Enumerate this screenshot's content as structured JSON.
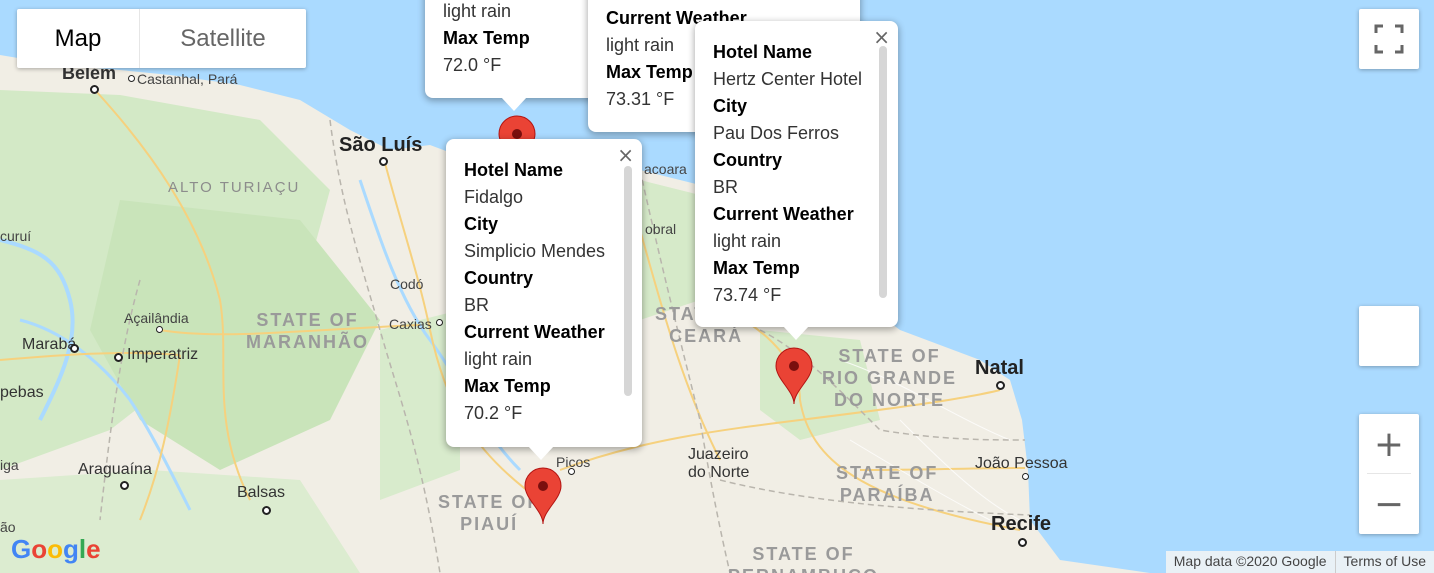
{
  "map_type": {
    "map_label": "Map",
    "satellite_label": "Satellite",
    "selected": "Map"
  },
  "places": {
    "belem": "Belém",
    "castanhal": "Castanhal, Pará",
    "sao_luis": "São Luís",
    "alto_turiacu": "ALTO TURIAÇU",
    "coroatá": "Codó",
    "caxias": "Caxias",
    "acailandia": "Açailândia",
    "maraba": "Marabá",
    "imperatriz": "Imperatriz",
    "araguaina": "Araguaína",
    "balsas": "Balsas",
    "picos": "Picos",
    "juazeiro": "Juazeiro\ndo Norte",
    "natal": "Natal",
    "joao_pessoa": "João Pessoa",
    "recife": "Recife",
    "jacobina_partial": "curuí",
    "pebas_partial": "pebas",
    "iga_partial": "iga",
    "sobral_partial": "obral",
    "camocim_partial": "acoara",
    "ao_partial": "ão"
  },
  "regions": {
    "maranhao": "STATE OF\nMARANHÃO",
    "piaui": "STATE OF\nPIAUÍ",
    "ceara": "STATE OF\nCEARÁ",
    "rio_grande_do_norte": "STATE OF\nRIO GRANDE\nDO NORTE",
    "paraiba": "STATE OF\nPARAÍBA",
    "pernambuco": "STATE OF\nPERNAMBUCO"
  },
  "info_windows": [
    {
      "id": "pau-dos-ferros",
      "hotel_label": "Hotel Name",
      "hotel": "Hertz Center Hotel",
      "city_label": "City",
      "city": "Pau Dos Ferros",
      "country_label": "Country",
      "country": "BR",
      "weather_label": "Current Weather",
      "weather": "light rain",
      "temp_label": "Max Temp",
      "temp": "73.74 °F"
    },
    {
      "id": "simplicio-mendes",
      "hotel_label": "Hotel Name",
      "hotel": "Fidalgo",
      "city_label": "City",
      "city": "Simplicio Mendes",
      "country_label": "Country",
      "country": "BR",
      "weather_label": "Current Weather",
      "weather": "light rain",
      "temp_label": "Max Temp",
      "temp": "70.2 °F"
    },
    {
      "id": "partial-top-left",
      "weather": "light rain",
      "temp_label": "Max Temp",
      "temp": "72.0 °F"
    },
    {
      "id": "partial-top-middle",
      "weather_label": "Current Weather",
      "weather": "light rain",
      "temp_label": "Max Temp",
      "temp": "73.31 °F"
    }
  ],
  "close_glyph": "×",
  "controls": {
    "zoom_in": "+",
    "zoom_out": "−"
  },
  "logo": {
    "letters": [
      "G",
      "o",
      "o",
      "g",
      "l",
      "e"
    ],
    "colors": [
      "#4285F4",
      "#EA4335",
      "#FBBC05",
      "#4285F4",
      "#34A853",
      "#EA4335"
    ]
  },
  "attribution": {
    "map_data": "Map data ©2020 Google",
    "terms": "Terms of Use"
  },
  "colors": {
    "water": "#aadaff",
    "land": "#f3efe6",
    "green": "#cfe8c3",
    "pin": "#ea4335",
    "road": "#f7d58a"
  }
}
